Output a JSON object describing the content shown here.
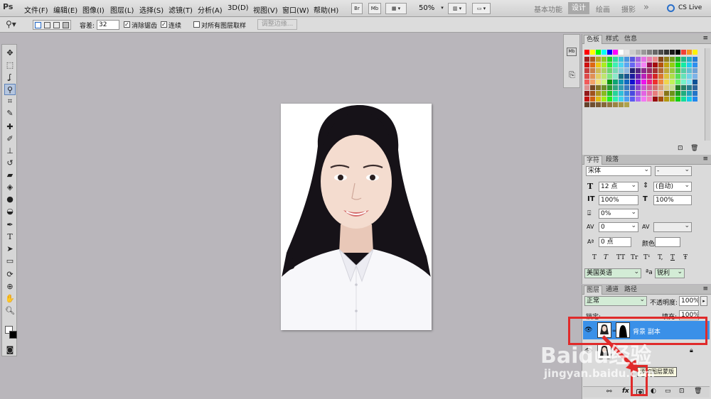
{
  "app": {
    "logo": "Ps"
  },
  "menu": [
    "文件(F)",
    "编辑(E)",
    "图像(I)",
    "图层(L)",
    "选择(S)",
    "滤镜(T)",
    "分析(A)",
    "3D(D)",
    "视图(V)",
    "窗口(W)",
    "帮助(H)"
  ],
  "menubar_buttons": {
    "br": "Br",
    "mb": "Mb",
    "zoom": "50%"
  },
  "workspaces": {
    "items": [
      "基本功能",
      "设计",
      "绘画",
      "摄影"
    ],
    "more": "»",
    "cs_live": "CS Live"
  },
  "options": {
    "tolerance_label": "容差:",
    "tolerance_value": "32",
    "antialias": "消除锯齿",
    "contiguous": "连续",
    "all_layers": "对所有图层取样",
    "refine_edge": "调整边缘..."
  },
  "panels": {
    "swatches_tabs": [
      "色板",
      "样式",
      "信息"
    ],
    "character_tabs": [
      "字符",
      "段落"
    ],
    "character": {
      "font": "宋体",
      "style": "-",
      "size": "12 点",
      "leading": "(自动)",
      "vscale": "100%",
      "hscale": "100%",
      "baseline": "0 点",
      "tracking_pct": "0%",
      "kerning": "0",
      "color_label": "颜色:",
      "language": "美国英语",
      "aa": "锐利",
      "aa_icon": "ªa",
      "style_buttons": [
        "T",
        "T",
        "TT",
        "Tr",
        "T¹",
        "T,",
        "T",
        "Ŧ"
      ]
    },
    "layers_tabs": [
      "图层",
      "通道",
      "路径"
    ],
    "layers": {
      "blend": "正常",
      "opacity_label": "不透明度:",
      "opacity": "100%",
      "lock_label": "锁定:",
      "fill_label": "填充:",
      "fill": "100%",
      "rows": [
        {
          "name": "背景 副本"
        }
      ],
      "tooltip": "添加图层蒙版"
    }
  },
  "swatch_colors": [
    "#ff0000",
    "#ffff00",
    "#00ff00",
    "#00ffff",
    "#0000ff",
    "#ff00ff",
    "#ffffff",
    "#e5e5e5",
    "#cccccc",
    "#b2b2b2",
    "#999999",
    "#7f7f7f",
    "#666666",
    "#4c4c4c",
    "#333333",
    "#191919",
    "#000000",
    "#ef4136",
    "#f7941d",
    "#fff200"
  ],
  "watermark": {
    "brand": "Baidu经验",
    "url": "jingyan.baidu.com"
  }
}
